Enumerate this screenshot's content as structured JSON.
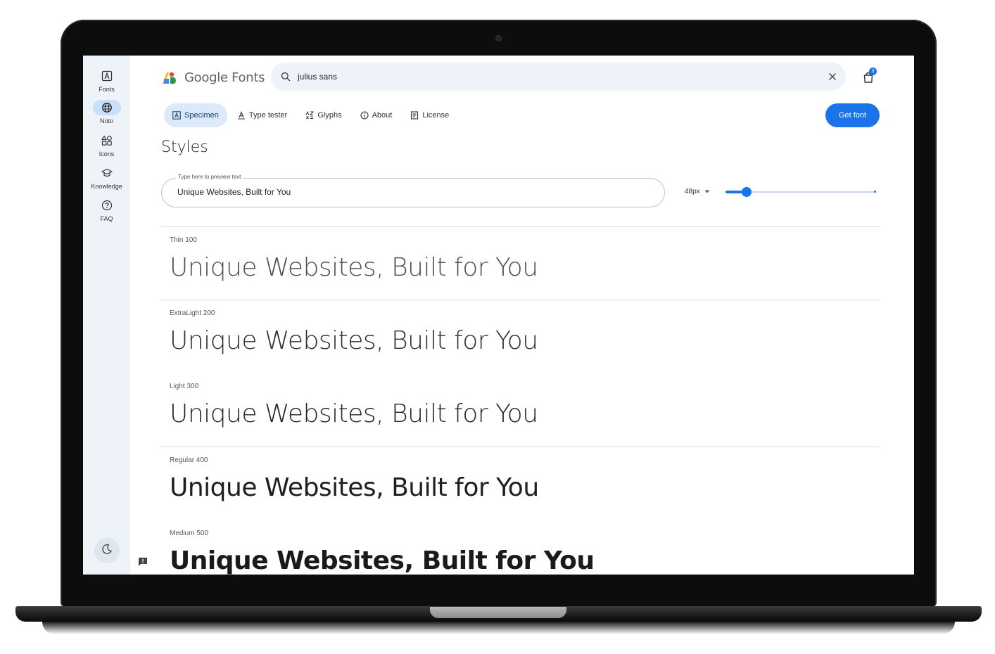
{
  "rail": {
    "items": [
      {
        "label": "Fonts",
        "icon": "font-icon"
      },
      {
        "label": "Noto",
        "icon": "globe-icon"
      },
      {
        "label": "Icons",
        "icon": "shapes-icon"
      },
      {
        "label": "Knowledge",
        "icon": "graduation-cap-icon"
      },
      {
        "label": "FAQ",
        "icon": "help-icon"
      }
    ],
    "active": "Noto",
    "theme_icon": "moon-icon"
  },
  "header": {
    "logo_text": "Google Fonts",
    "search": {
      "value": "julius sans",
      "icon": "search-icon"
    },
    "cart_count": "3"
  },
  "tabs": [
    {
      "label": "Specimen",
      "icon": "specimen-icon",
      "active": true
    },
    {
      "label": "Type tester",
      "icon": "type-tester-icon",
      "active": false
    },
    {
      "label": "Glyphs",
      "icon": "glyphs-icon",
      "active": false
    },
    {
      "label": "About",
      "icon": "info-icon",
      "active": false
    },
    {
      "label": "License",
      "icon": "license-icon",
      "active": false
    }
  ],
  "get_font_label": "Get font",
  "styles": {
    "title": "Styles",
    "preview_legend": "Type here to preview text",
    "preview_value": "Unique Websites, Built for You",
    "size_value": "48px",
    "size_fraction": 0.14,
    "rows": [
      {
        "label": "Thin 100",
        "sample": "Unique Websites, Built for You",
        "weight": "100"
      },
      {
        "label": "ExtraLight 200",
        "sample": "Unique Websites, Built for You",
        "weight": "200"
      },
      {
        "label": "Light 300",
        "sample": "Unique Websites, Built for You",
        "weight": "300"
      },
      {
        "label": "Regular 400",
        "sample": "Unique Websites, Built for You",
        "weight": "400"
      },
      {
        "label": "Medium 500",
        "sample": "Unique Websites, Built for You",
        "weight": "500"
      }
    ]
  },
  "colors": {
    "accent": "#1a73e8",
    "rail_bg": "#eef3fa",
    "active_tab_bg": "#dce9fa"
  }
}
